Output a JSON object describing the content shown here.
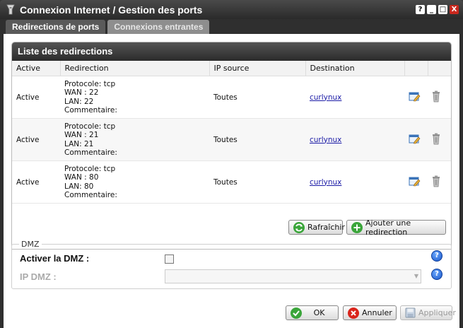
{
  "window": {
    "title": "Connexion Internet / Gestion des ports",
    "controls": [
      "?",
      "_",
      "□",
      "X"
    ]
  },
  "tabs": [
    {
      "label": "Redirections de ports",
      "active": true
    },
    {
      "label": "Connexions entrantes",
      "active": false
    }
  ],
  "redirections": {
    "title": "Liste des redirections",
    "columns": [
      "Active",
      "Redirection",
      "IP source",
      "Destination",
      "",
      ""
    ],
    "rows": [
      {
        "active": "Active",
        "protocol": "Protocole: tcp",
        "wan": "WAN : 22",
        "lan": "LAN: 22",
        "comment": "Commentaire:",
        "ip_source": "Toutes",
        "destination": "curlynux"
      },
      {
        "active": "Active",
        "protocol": "Protocole: tcp",
        "wan": "WAN : 21",
        "lan": "LAN: 21",
        "comment": "Commentaire:",
        "ip_source": "Toutes",
        "destination": "curlynux"
      },
      {
        "active": "Active",
        "protocol": "Protocole: tcp",
        "wan": "WAN : 80",
        "lan": "LAN: 80",
        "comment": "Commentaire:",
        "ip_source": "Toutes",
        "destination": "curlynux"
      }
    ],
    "refresh_label": "Rafraîchir",
    "add_label": "Ajouter une redirection"
  },
  "dmz": {
    "legend": "DMZ",
    "enable_label": "Activer la DMZ :",
    "enabled": false,
    "ip_label": "IP DMZ :",
    "ip_value": ""
  },
  "footer": {
    "ok_label": "OK",
    "cancel_label": "Annuler",
    "apply_label": "Appliquer"
  },
  "colors": {
    "titlebar": "#2f2f2f",
    "ok_green": "#3aa53a",
    "cancel_red": "#d9251c",
    "help_blue": "#1a56c8"
  }
}
